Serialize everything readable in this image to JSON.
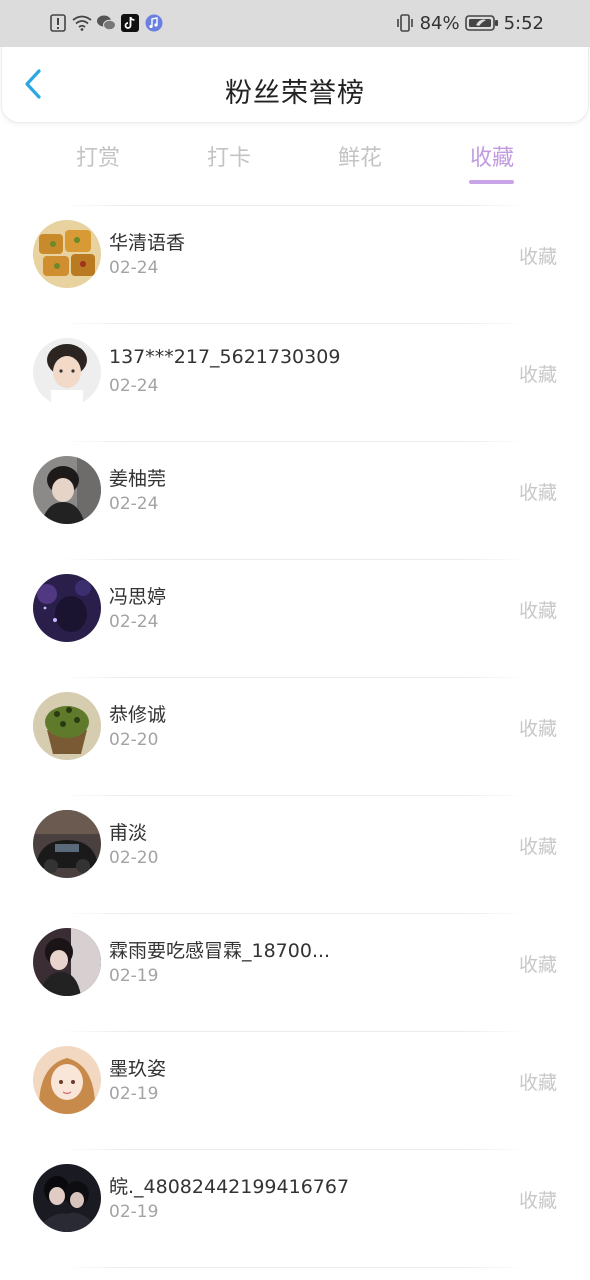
{
  "status_bar": {
    "battery": "84%",
    "time": "5:52",
    "left_icons": [
      "alert-icon",
      "wifi-icon",
      "wechat-icon",
      "tiktok-icon",
      "music-icon"
    ],
    "right_icons": [
      "vibrate-icon",
      "battery-icon"
    ]
  },
  "header": {
    "title": "粉丝荣誉榜",
    "back_icon": "chevron-left-icon",
    "accent_color": "#29a8e0"
  },
  "tabs": [
    {
      "label": "打赏",
      "active": false
    },
    {
      "label": "打卡",
      "active": false
    },
    {
      "label": "鲜花",
      "active": false
    },
    {
      "label": "收藏",
      "active": true
    }
  ],
  "tab_active_color": "#c29be0",
  "fans": [
    {
      "name": "华清语香",
      "date": "02-24",
      "action": "收藏"
    },
    {
      "name": "137***217_5621730309",
      "date": "02-24",
      "action": "收藏"
    },
    {
      "name": "姜柚莞",
      "date": "02-24",
      "action": "收藏"
    },
    {
      "name": "冯思婷",
      "date": "02-24",
      "action": "收藏"
    },
    {
      "name": "恭修诚",
      "date": "02-20",
      "action": "收藏"
    },
    {
      "name": "甫淡",
      "date": "02-20",
      "action": "收藏"
    },
    {
      "name": "霖雨要吃感冒霖_18700...",
      "date": "02-19",
      "action": "收藏"
    },
    {
      "name": "墨玖姿",
      "date": "02-19",
      "action": "收藏"
    },
    {
      "name": "皖._48082442199416767",
      "date": "02-19",
      "action": "收藏"
    }
  ]
}
